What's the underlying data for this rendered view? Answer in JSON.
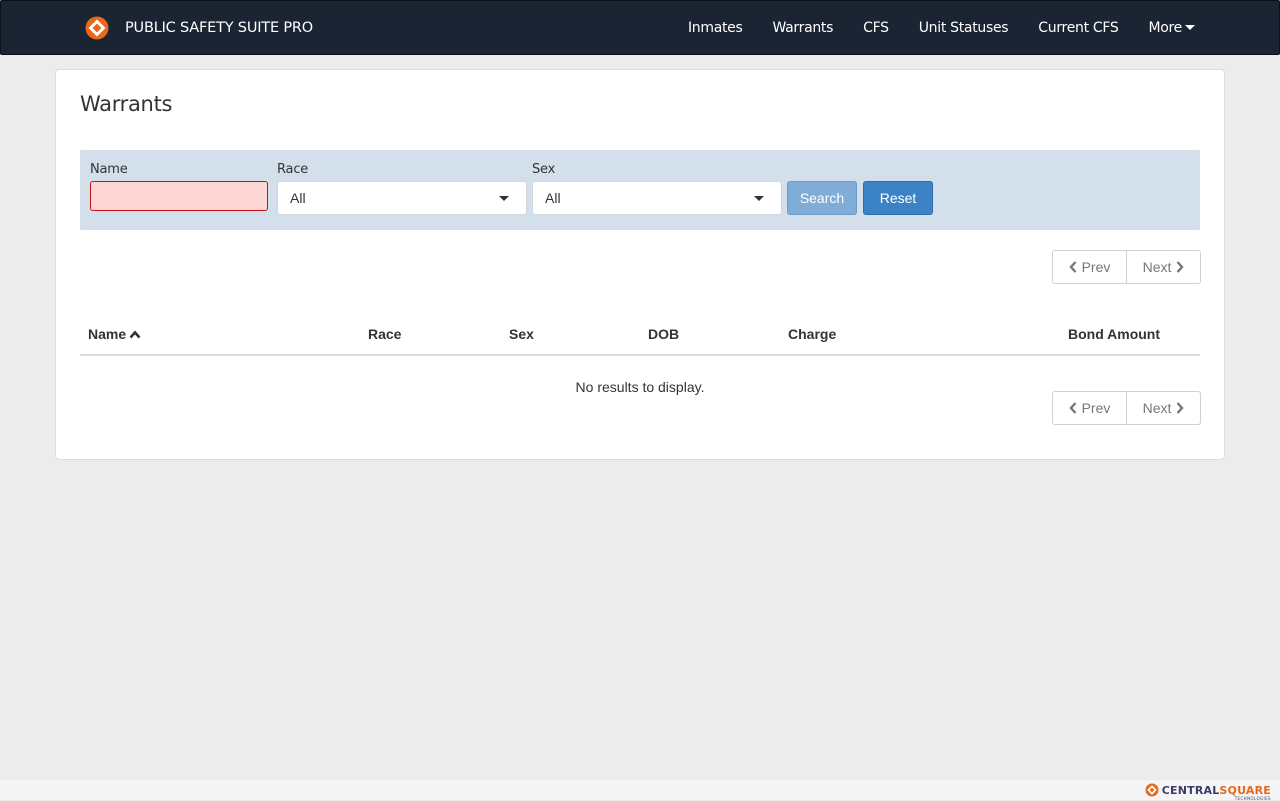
{
  "brand": {
    "name": "PUBLIC SAFETY SUITE PRO",
    "accent": "#e8681c"
  },
  "nav": {
    "items": [
      {
        "label": "Inmates"
      },
      {
        "label": "Warrants"
      },
      {
        "label": "CFS"
      },
      {
        "label": "Unit Statuses"
      },
      {
        "label": "Current CFS"
      }
    ],
    "more_label": "More"
  },
  "page": {
    "title": "Warrants"
  },
  "filters": {
    "name_label": "Name",
    "name_value": "",
    "race_label": "Race",
    "race_value": "All",
    "sex_label": "Sex",
    "sex_value": "All",
    "search_label": "Search",
    "reset_label": "Reset"
  },
  "pager": {
    "prev_label": "Prev",
    "next_label": "Next"
  },
  "table": {
    "columns": [
      "Name",
      "Race",
      "Sex",
      "DOB",
      "Charge",
      "Bond Amount"
    ],
    "sorted_column": "Name",
    "sort_direction": "ascending",
    "empty_message": "No results to display."
  },
  "footer": {
    "logo_text_a": "CENTRAL",
    "logo_text_b": "SQUARE",
    "logo_sub": "TECHNOLOGIES"
  },
  "colors": {
    "navbar_bg": "#1b2433",
    "filter_panel_bg": "#d3dfeb",
    "search_button": "#7fadd8",
    "reset_button": "#3b83c6",
    "invalid_field_bg": "#fdd6d6",
    "invalid_field_border": "#c81414"
  }
}
